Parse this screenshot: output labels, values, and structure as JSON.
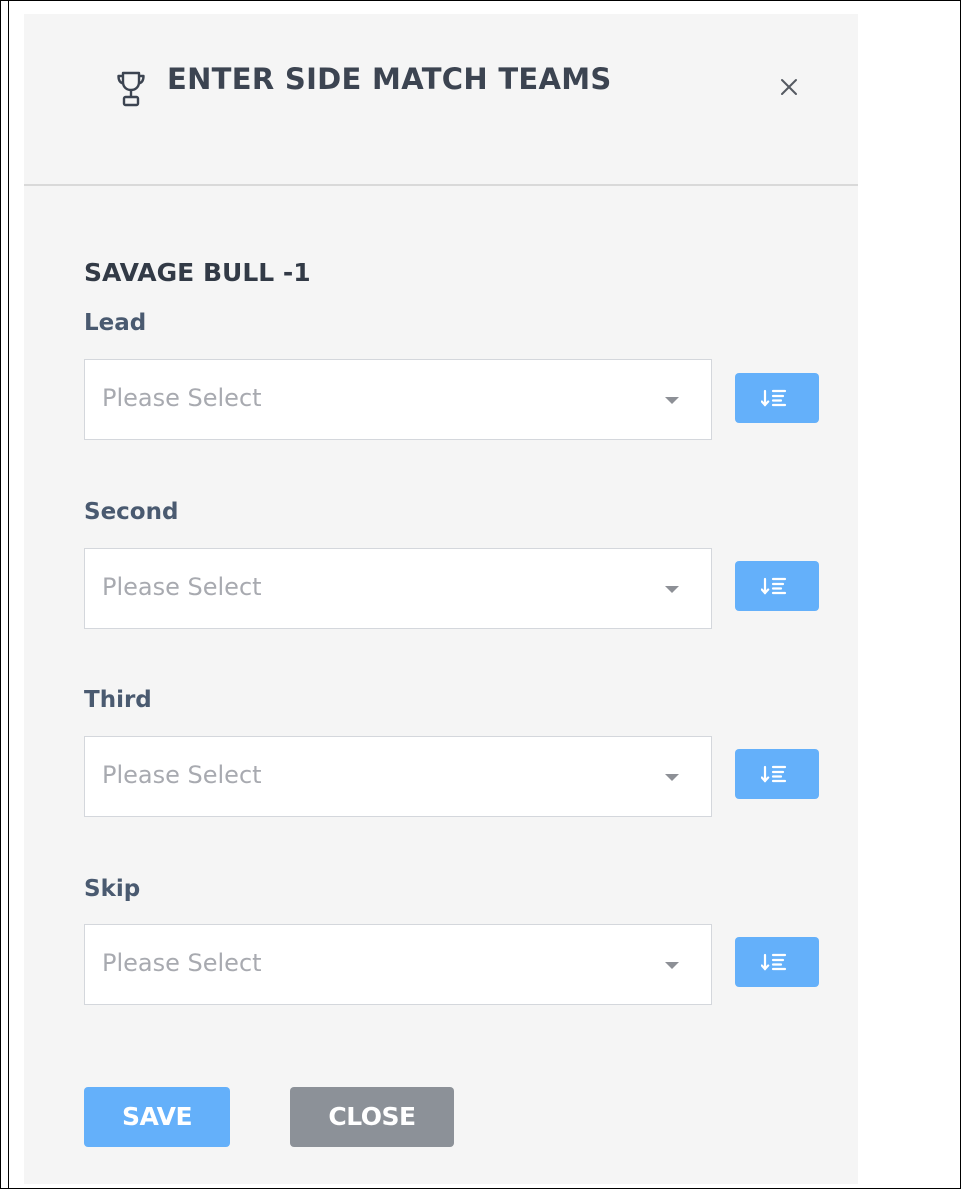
{
  "dialog": {
    "title": "ENTER SIDE MATCH TEAMS",
    "title_icon": "trophy-icon",
    "close_icon": "close-icon"
  },
  "team": {
    "name": "SAVAGE BULL -1"
  },
  "fields": [
    {
      "label": "Lead",
      "placeholder": "Please Select"
    },
    {
      "label": "Second",
      "placeholder": "Please Select"
    },
    {
      "label": "Third",
      "placeholder": "Please Select"
    },
    {
      "label": "Skip",
      "placeholder": "Please Select"
    }
  ],
  "sort_button_icon": "sort-list-icon",
  "actions": {
    "save_label": "SAVE",
    "close_label": "CLOSE"
  },
  "colors": {
    "primary": "#64b0fa",
    "secondary": "#8c9198",
    "panel_bg": "#f5f5f5"
  }
}
